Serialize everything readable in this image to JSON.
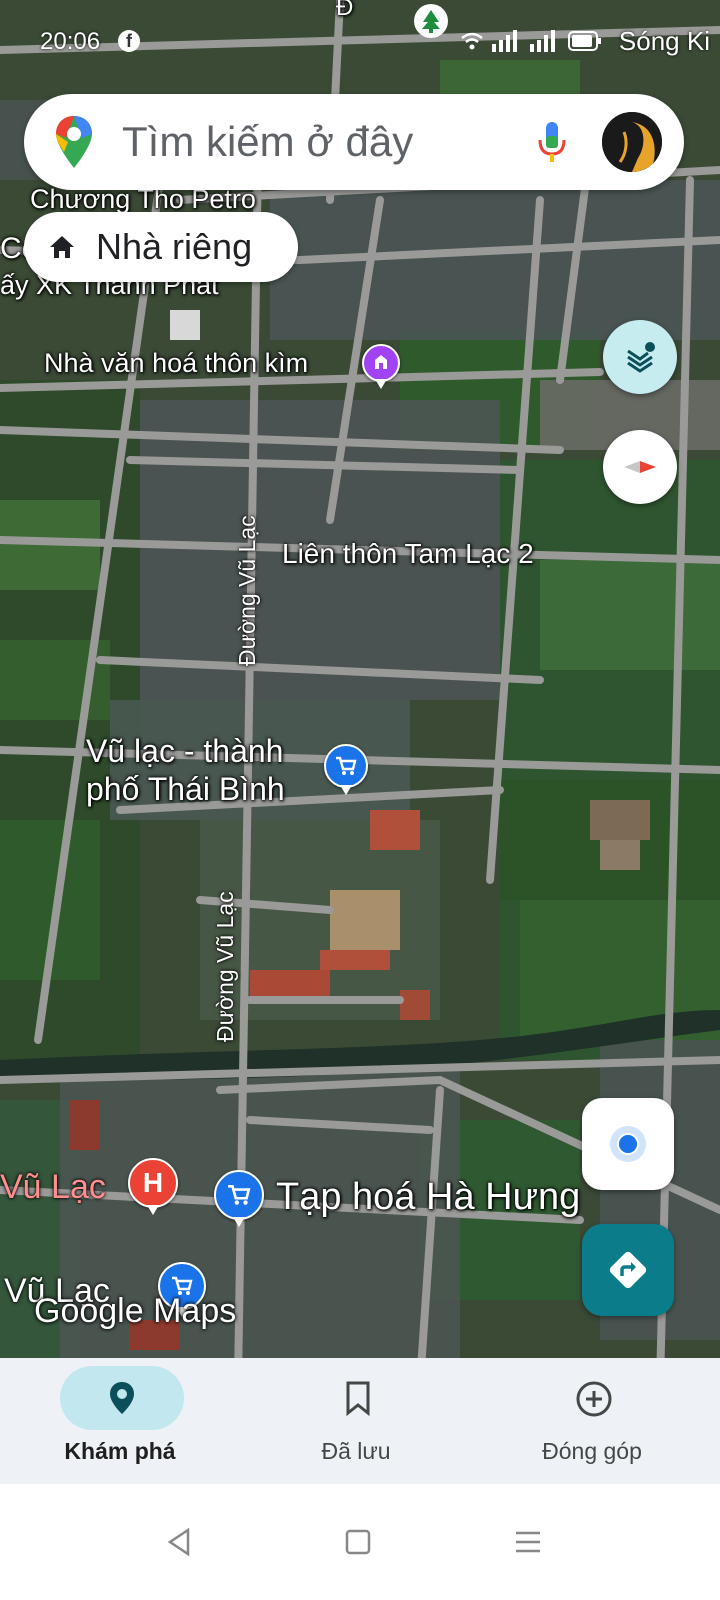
{
  "status_bar": {
    "time": "20:06",
    "carrier": "Sóng Ki"
  },
  "search": {
    "placeholder": "Tìm kiếm ở đây"
  },
  "chips": {
    "home_label": "Nhà riêng"
  },
  "map": {
    "labels": {
      "chuong_tho_petro": "Chương Tho Petro",
      "co": "Cô",
      "xk_thanh_phat": "ấy XK Thanh Phát",
      "nha_van_hoa": "Nhà văn hoá thôn kìm",
      "lien_thon": "Liên thôn Tam Lạc 2",
      "duong_vu_lac_1": "Đường Vũ Lạc",
      "duong_vu_lac_2": "Đường Vũ Lạc",
      "vu_lac_tp_line1": "Vũ lạc - thành",
      "vu_lac_tp_line2": "phố Thái Bình",
      "vu_lac_red": "Vũ Lạc",
      "tap_hoa": "Tạp hoá Hà Hưng",
      "vu_lac_bottom": "Vũ Lạc",
      "top_road_fragment": "Đ"
    },
    "watermark": "Google Maps",
    "pin_icons": [
      "shopping-cart-icon",
      "hospital-icon",
      "monument-icon"
    ]
  },
  "bottom_nav": {
    "items": [
      {
        "label": "Khám phá",
        "icon": "location-pin-icon",
        "active": true
      },
      {
        "label": "Đã lưu",
        "icon": "bookmark-icon",
        "active": false
      },
      {
        "label": "Đóng góp",
        "icon": "add-circle-icon",
        "active": false
      }
    ]
  },
  "colors": {
    "accent_teal": "#0b7c8a",
    "nav_active_pill": "#c2e7ef",
    "pin_blue": "#1a73e8",
    "pin_red": "#ea4335"
  }
}
